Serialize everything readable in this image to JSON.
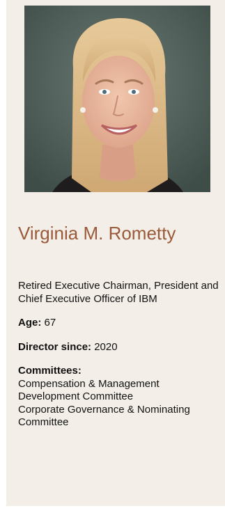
{
  "profile": {
    "name": "Virginia M. Rometty",
    "title": "Retired Executive Chairman, President and Chief Executive Officer of IBM",
    "age_label": "Age:",
    "age_value": "67",
    "director_label": "Director since:",
    "director_value": "2020",
    "committees_label": "Committees:",
    "committees": [
      "Compensation & Management Development Committee",
      "Corporate Governance & Nominating Committee"
    ]
  },
  "colors": {
    "card_background": "#f3efe8",
    "name_accent": "#9a5a3a",
    "text": "#111111"
  }
}
